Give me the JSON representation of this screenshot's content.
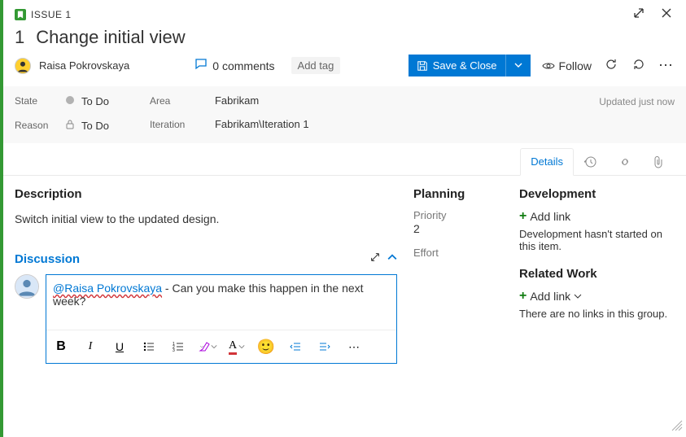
{
  "header": {
    "issue_label": "ISSUE 1",
    "issue_number": "1",
    "title": "Change initial view"
  },
  "meta": {
    "author": "Raisa Pokrovskaya",
    "comments_label": "0 comments",
    "add_tag": "Add tag"
  },
  "actions": {
    "save_close": "Save & Close",
    "follow": "Follow"
  },
  "fields": {
    "state_label": "State",
    "state_value": "To Do",
    "reason_label": "Reason",
    "reason_value": "To Do",
    "area_label": "Area",
    "area_value": "Fabrikam",
    "iteration_label": "Iteration",
    "iteration_value": "Fabrikam\\Iteration 1",
    "updated": "Updated just now"
  },
  "tabs": {
    "details": "Details"
  },
  "description": {
    "title": "Description",
    "text": "Switch initial view to the updated design."
  },
  "discussion": {
    "title": "Discussion",
    "mention": "@Raisa Pokrovskaya",
    "message_rest": " - Can you make this happen in the next week?"
  },
  "planning": {
    "title": "Planning",
    "priority_label": "Priority",
    "priority_value": "2",
    "effort_label": "Effort"
  },
  "development": {
    "title": "Development",
    "add_link": "Add link",
    "info": "Development hasn't started on this item."
  },
  "related": {
    "title": "Related Work",
    "add_link": "Add link",
    "info": "There are no links in this group."
  }
}
